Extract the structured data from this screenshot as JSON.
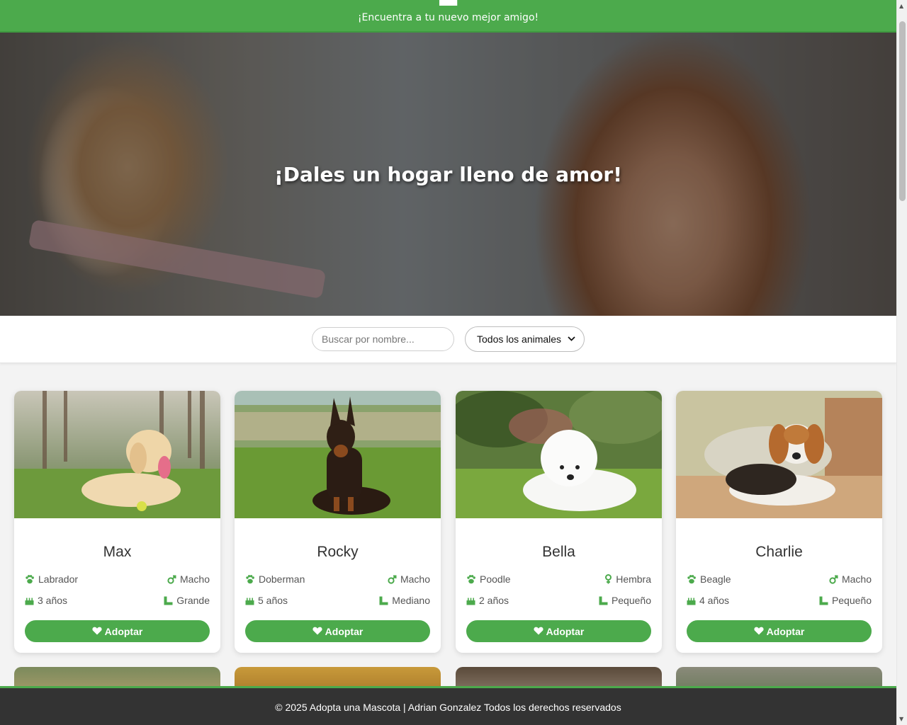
{
  "header": {
    "subtitle": "¡Encuentra a tu nuevo mejor amigo!",
    "bg_color": "#4caa4c"
  },
  "hero": {
    "title": "¡Dales un hogar lleno de amor!"
  },
  "filters": {
    "search_placeholder": "Buscar por nombre...",
    "animal_select_value": "Todos los animales"
  },
  "pets": [
    {
      "name": "Max",
      "breed": "Labrador",
      "sex": "Macho",
      "sex_icon": "male-icon",
      "age": "3 años",
      "size": "Grande",
      "button": "Adoptar"
    },
    {
      "name": "Rocky",
      "breed": "Doberman",
      "sex": "Macho",
      "sex_icon": "male-icon",
      "age": "5 años",
      "size": "Mediano",
      "button": "Adoptar"
    },
    {
      "name": "Bella",
      "breed": "Poodle",
      "sex": "Hembra",
      "sex_icon": "female-icon",
      "age": "2 años",
      "size": "Pequeño",
      "button": "Adoptar"
    },
    {
      "name": "Charlie",
      "breed": "Beagle",
      "sex": "Macho",
      "sex_icon": "male-icon",
      "age": "4 años",
      "size": "Pequeño",
      "button": "Adoptar"
    }
  ],
  "footer": {
    "text": "© 2025 Adopta una Mascota | Adrian Gonzalez Todos los derechos reservados"
  },
  "colors": {
    "accent": "#4caa4c",
    "footer_bg": "#333333"
  }
}
